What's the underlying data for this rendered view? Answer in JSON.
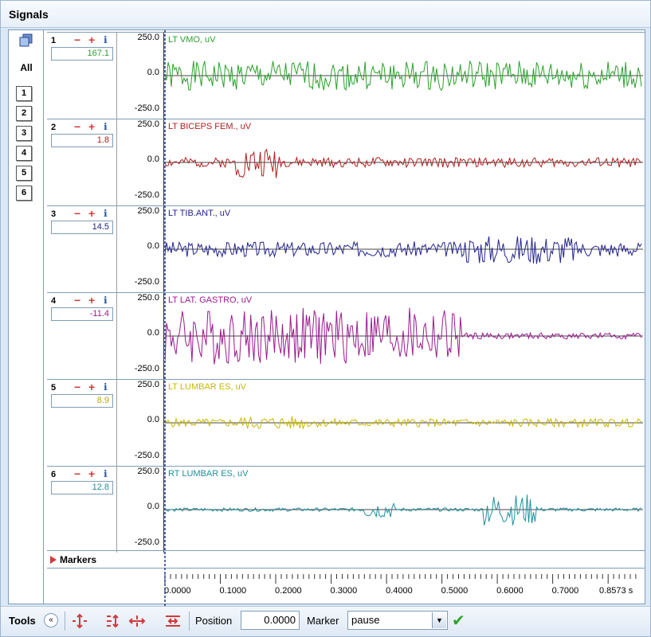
{
  "window": {
    "title": "Signals"
  },
  "left_panel": {
    "all_label": "All",
    "channel_buttons": [
      "1",
      "2",
      "3",
      "4",
      "5",
      "6"
    ]
  },
  "channels": [
    {
      "number": "1",
      "value": "167.1",
      "label": "LT VMO, uV",
      "ymax": "250.0",
      "ymid": "0.0",
      "ymin": "-250.0",
      "color": "#2aa02a",
      "value_color": "#2aa02a",
      "trace": {
        "amplitude": 0.42,
        "bursts": [],
        "seed": 1
      }
    },
    {
      "number": "2",
      "value": "1.8",
      "label": "LT BICEPS FEM., uV",
      "ymax": "250.0",
      "ymid": "0.0",
      "ymin": "-250.0",
      "color": "#b02020",
      "value_color": "#b02020",
      "trace": {
        "amplitude": 0.14,
        "bursts": [
          [
            0.15,
            0.24,
            3.2
          ]
        ],
        "seed": 2
      }
    },
    {
      "number": "3",
      "value": "14.5",
      "label": "LT TIB.ANT., uV",
      "ymax": "250.0",
      "ymid": "0.0",
      "ymin": "-250.0",
      "color": "#23238f",
      "value_color": "#23238f",
      "trace": {
        "amplitude": 0.22,
        "bursts": [
          [
            0.63,
            0.86,
            1.9
          ]
        ],
        "seed": 3
      }
    },
    {
      "number": "4",
      "value": "-11.4",
      "label": "LT LAT. GASTRO, uV",
      "ymax": "250.0",
      "ymid": "0.0",
      "ymin": "-250.0",
      "color": "#9a1a8f",
      "value_color": "#9a1a8f",
      "trace": {
        "amplitude": 0.09,
        "bursts": [
          [
            0.0,
            0.62,
            9.0
          ]
        ],
        "seed": 4
      }
    },
    {
      "number": "5",
      "value": "8.9",
      "label": "LT LUMBAR ES, uV",
      "ymax": "250.0",
      "ymid": "0.0",
      "ymin": "-250.0",
      "color": "#c8b800",
      "value_color": "#b8a800",
      "trace": {
        "amplitude": 0.12,
        "bursts": [
          [
            0.15,
            0.3,
            1.6
          ]
        ],
        "seed": 5
      }
    },
    {
      "number": "6",
      "value": "12.8",
      "label": "RT LUMBAR ES, uV",
      "ymax": "250.0",
      "ymid": "0.0",
      "ymin": "-250.0",
      "color": "#1f8f9c",
      "value_color": "#1f8f9c",
      "trace": {
        "amplitude": 0.05,
        "bursts": [
          [
            0.42,
            0.48,
            5.0
          ],
          [
            0.67,
            0.78,
            9.0
          ]
        ],
        "seed": 6
      }
    }
  ],
  "markers": {
    "label": "Markers"
  },
  "time_axis": {
    "ticks": [
      "0.0000",
      "0.1000",
      "0.2000",
      "0.3000",
      "0.4000",
      "0.5000",
      "0.6000",
      "0.7000",
      "0.8573 s"
    ],
    "tick_values": [
      0,
      0.1,
      0.2,
      0.3,
      0.4,
      0.5,
      0.6,
      0.7,
      0.8573
    ],
    "max": 0.8573
  },
  "toolbar": {
    "tools_label": "Tools",
    "position_label": "Position",
    "position_value": "0.0000",
    "marker_label": "Marker",
    "marker_value": "pause"
  }
}
